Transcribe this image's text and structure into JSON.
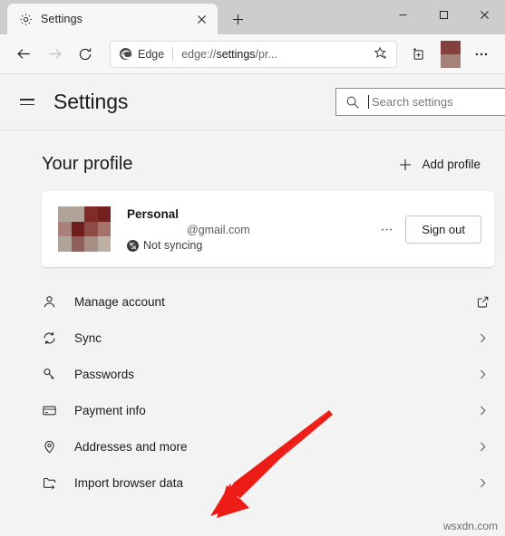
{
  "window": {
    "controls": {
      "minimize": "minimize-icon",
      "maximize": "maximize-icon",
      "close": "close-icon"
    }
  },
  "tabs": [
    {
      "title": "Settings",
      "favicon": "gear-icon",
      "close": "close-icon",
      "active": true
    }
  ],
  "new_tab_label": "+",
  "toolbar": {
    "back": "back-arrow-icon",
    "forward": "forward-arrow-icon",
    "refresh": "refresh-icon",
    "omnibox": {
      "brand": "Edge",
      "brand_icon": "edge-logo-icon",
      "url_prefix": "edge://",
      "url_highlight": "settings",
      "url_suffix": "/pr...",
      "url_full": "edge://settings/pr...",
      "favorite_icon": "star-add-icon"
    },
    "collections": "collections-icon",
    "profile_avatar": "profile-avatar-pixelated",
    "more": "more-ellipsis-icon"
  },
  "settings_header": {
    "menu_icon": "hamburger-icon",
    "title": "Settings",
    "search": {
      "icon": "search-icon",
      "placeholder": "Search settings",
      "value": ""
    }
  },
  "main": {
    "section_title": "Your profile",
    "add_profile": {
      "icon": "plus-icon",
      "label": "Add profile"
    },
    "profile_card": {
      "avatar": "pixelated-avatar",
      "avatar_colors": [
        "#b0a49a",
        "#b0a49a",
        "#7e2b2a",
        "#761f1f",
        "#a9817a",
        "#701d1d",
        "#8d4b45",
        "#a5736c",
        "#b0a49a",
        "#8d5f58",
        "#a98e85",
        "#bcb0a4"
      ],
      "name": "Personal",
      "email": "@gmail.com",
      "sync_status": "Not syncing",
      "sync_icon": "sync-disabled-icon",
      "more_icon": "ellipsis-icon",
      "signout_label": "Sign out"
    },
    "list": [
      {
        "label": "Manage account",
        "icon": "person-icon",
        "end": "external-link-icon"
      },
      {
        "label": "Sync",
        "icon": "sync-icon",
        "end": "chevron-right-icon"
      },
      {
        "label": "Passwords",
        "icon": "key-icon",
        "end": "chevron-right-icon"
      },
      {
        "label": "Payment info",
        "icon": "credit-card-icon",
        "end": "chevron-right-icon"
      },
      {
        "label": "Addresses and more",
        "icon": "location-pin-icon",
        "end": "chevron-right-icon"
      },
      {
        "label": "Import browser data",
        "icon": "import-folder-icon",
        "end": "chevron-right-icon"
      }
    ]
  },
  "annotation": {
    "arrow_color": "#ed1c16",
    "points_to": "Import browser data"
  },
  "watermark": "wsxdn.com",
  "colors": {
    "titlebar_bg": "#cdcdcd",
    "toolbar_bg": "#f7f7f7",
    "page_bg": "#f3f3f3",
    "card_bg": "#ffffff",
    "text": "#1b1b1b",
    "muted_text": "#5b5b5b",
    "arrow_red": "#ed1c16"
  }
}
